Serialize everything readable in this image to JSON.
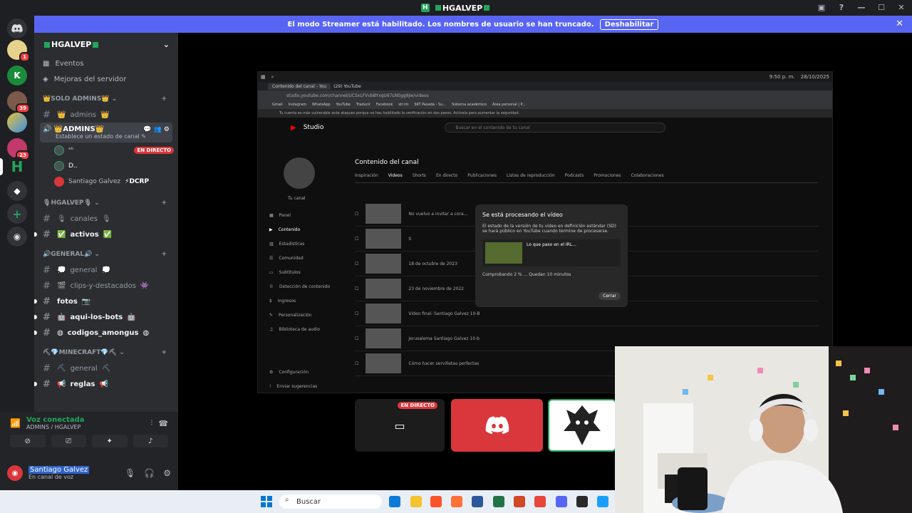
{
  "window": {
    "title": "HGALVEP"
  },
  "banner": {
    "text": "El modo Streamer está habilitado. Los nombres de usuario se han truncado.",
    "button": "Deshabilitar"
  },
  "rail": {
    "badges": [
      "1",
      "39",
      "23"
    ]
  },
  "server": {
    "name": "HGALVEP",
    "nav": [
      {
        "label": "Eventos",
        "icon": "calendar-icon"
      },
      {
        "label": "Mejoras del servidor",
        "icon": "boost-icon"
      }
    ],
    "cat_solo": "SOLO ADMINS",
    "ch_admins": "admins",
    "voice_admins": "ADMINS",
    "voice_admins_status": "Establece un estado de canal",
    "voice_users": [
      {
        "name": "ᵃᵇ",
        "live": true,
        "live_label": "EN DIRECTO"
      },
      {
        "name": "D..",
        "live": false
      },
      {
        "name": "Santiago Galvez",
        "extra": "⚡DCRP",
        "live": false
      }
    ],
    "cat_hgalvep": "HGALVEP",
    "ch_canales": "canales",
    "ch_activos": "activos",
    "cat_general": "GENERAL",
    "ch_general": "general",
    "ch_clips": "clips-y-destacados",
    "ch_fotos": "fotos",
    "ch_bots": "aqui-los-bots",
    "ch_codigos": "codigos_amongus",
    "cat_minecraft": "MINECRAFT",
    "ch_mc_general": "general",
    "ch_reglas": "reglas"
  },
  "voice": {
    "status": "Voz conectada",
    "location": "ADMINS / HGALVEP"
  },
  "user": {
    "name": "Santiago Galvez",
    "status": "En canal de voz"
  },
  "stream": {
    "osbar_time": "9:50 p. m.",
    "osbar_date": "28/10/2025",
    "tab1": "Contenido del canal - You",
    "tab2": "(29) YouTube",
    "url": "studio.youtube.com/channel/UCSxLFVvbBYxqU67LNSgg8Jw/videos",
    "bookmarks": [
      "Gmail",
      "Instagram",
      "WhatsApp",
      "YouTube",
      "Traducir",
      "Facebook",
      "str.im",
      "SKT Pesada - Su...",
      "Sistema académico",
      "Área personal | P..."
    ],
    "warning": "Tu cuenta es más vulnerable ante ataques porque no has habilitado la verificación en dos pasos. Actívala para aumentar la seguridad.",
    "studio_label": "Studio",
    "search_placeholder": "Buscar en el contenido de tu canal",
    "channel_label": "Tu canal",
    "side_items": [
      "Panel",
      "Contenido",
      "Estadísticas",
      "Comunidad",
      "Subtítulos",
      "Detección de contenido",
      "Ingresos",
      "Personalización",
      "Biblioteca de audio"
    ],
    "side_bottom": [
      "Configuración",
      "Enviar sugerencias"
    ],
    "page_title": "Contenido del canal",
    "tabs": [
      "Inspiración",
      "Videos",
      "Shorts",
      "En directo",
      "Publicaciones",
      "Listas de reproducción",
      "Podcasts",
      "Promociones",
      "Colaboraciones"
    ],
    "rows": [
      "No vuelvo a invitar a cora...",
      "ti",
      "18 de octubre de 2023",
      "23 de noviembre de 2022",
      "Video final- Santiago Galvez 10-B",
      "Jerusalema Santiago Galvez 10-b",
      "Cómo hacer servilletas perfectas"
    ],
    "modal_title": "Se está procesando el vídeo",
    "modal_body": "El estado de la versión de tu vídeo en definición estándar (SD) se hará público en YouTube cuando termine de procesarse.",
    "modal_video": "Lo que paso en el IRL...",
    "modal_progress": "Comprobando 2 % ... Quedan 10 minutos",
    "modal_close": "Cerrar",
    "tile_live": "EN DIRECTO"
  },
  "taskbar": {
    "search": "Buscar"
  },
  "colors": {
    "blurple": "#5865f2",
    "green": "#23a55a",
    "red": "#da373c"
  }
}
